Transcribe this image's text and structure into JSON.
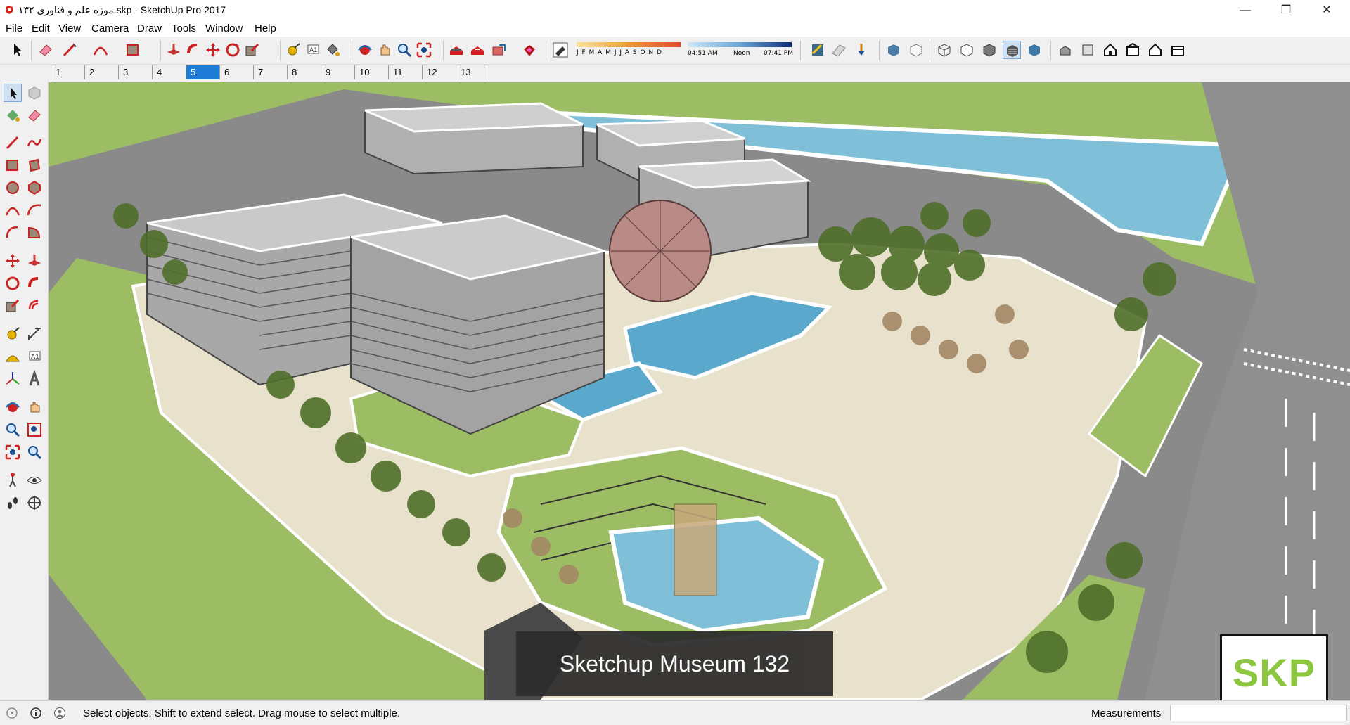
{
  "window": {
    "title": "موزه علم و فناوری ۱۳۲.skp - SketchUp Pro 2017",
    "controls": {
      "minimize": "—",
      "restore": "❐",
      "close": "✕"
    }
  },
  "menu": [
    "File",
    "Edit",
    "View",
    "Camera",
    "Draw",
    "Tools",
    "Window",
    "Help"
  ],
  "shadow_settings": {
    "months": "J F M A M J J A S O N D",
    "time_start": "04:51 AM",
    "time_mid": "Noon",
    "time_end": "07:41 PM"
  },
  "scene_tabs": [
    "1",
    "2",
    "3",
    "4",
    "5",
    "6",
    "7",
    "8",
    "9",
    "10",
    "11",
    "12",
    "13"
  ],
  "active_scene": "5",
  "caption": "Sketchup Museum 132",
  "logo": "SKP",
  "status": {
    "hint": "Select objects. Shift to extend select. Drag mouse to select multiple.",
    "measurements_label": "Measurements",
    "measurements_value": ""
  },
  "colors": {
    "accent": "#1e7bd6",
    "logo_green": "#8dc63f",
    "water": "#7fc0d8",
    "grass": "#9cbd63",
    "road": "#8a8a8a",
    "plaza": "#e8e1cc"
  }
}
